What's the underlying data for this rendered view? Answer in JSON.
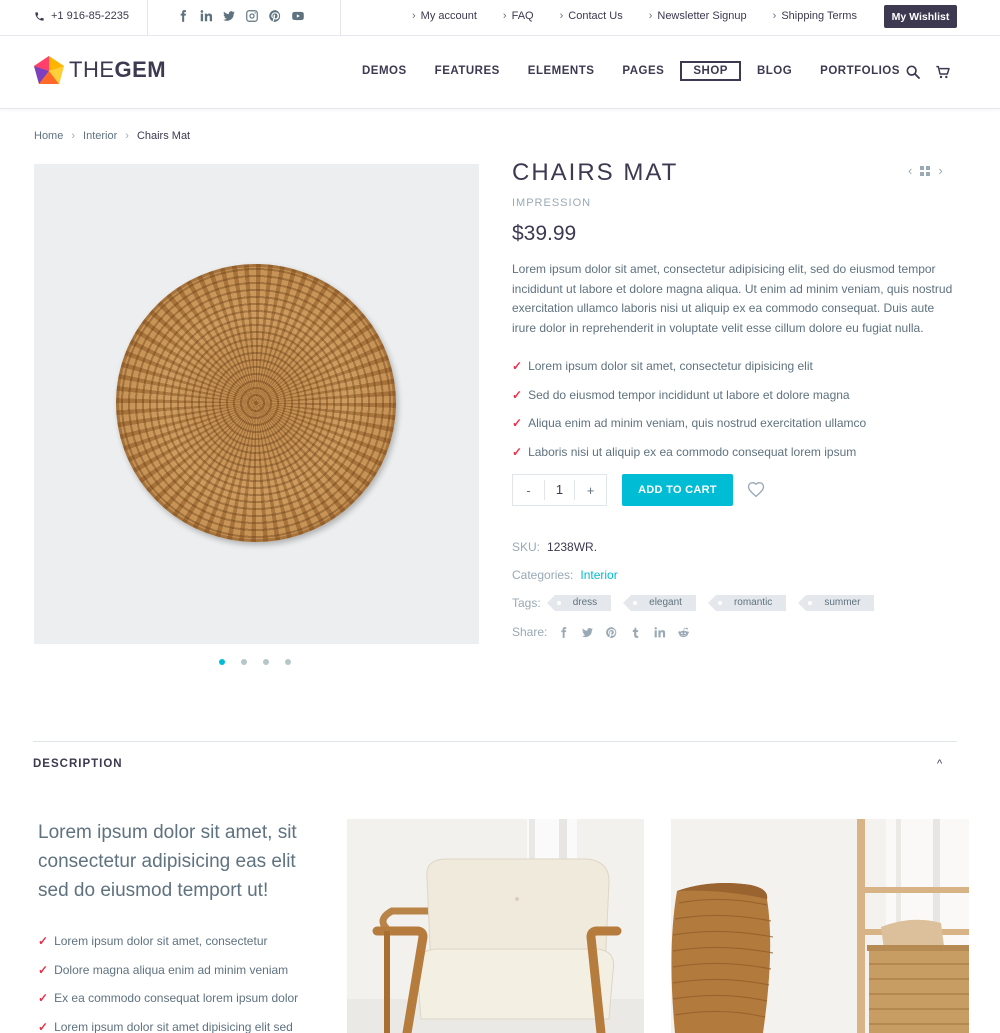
{
  "topbar": {
    "phone": "+1 916-85-2235",
    "social": [
      "facebook-icon",
      "linkedin-icon",
      "twitter-icon",
      "instagram-icon",
      "pinterest-icon",
      "youtube-icon"
    ],
    "links": [
      "My account",
      "FAQ",
      "Contact Us",
      "Newsletter Signup",
      "Shipping Terms"
    ],
    "wishlist_label": "My Wishlist"
  },
  "header": {
    "logo_thin": "THE",
    "logo_bold": "GEM",
    "nav": [
      "DEMOS",
      "FEATURES",
      "ELEMENTS",
      "PAGES",
      "SHOP",
      "BLOG",
      "PORTFOLIOS"
    ],
    "active_nav": "SHOP"
  },
  "breadcrumb": [
    "Home",
    "Interior",
    "Chairs Mat"
  ],
  "product": {
    "title": "CHAIRS MAT",
    "brand": "IMPRESSION",
    "price": "$39.99",
    "description": "Lorem ipsum dolor sit amet, consectetur adipisicing elit, sed do eiusmod tempor incididunt ut labore et dolore magna aliqua. Ut enim ad minim veniam, quis nostrud exercitation ullamco laboris nisi ut aliquip ex ea commodo consequat. Duis aute irure dolor in reprehenderit in voluptate velit esse cillum dolore eu fugiat nulla.",
    "features": [
      "Lorem ipsum dolor sit amet, consectetur dipisicing elit",
      "Sed do eiusmod tempor incididunt ut labore et dolore magna",
      "Aliqua enim ad minim veniam, quis nostrud exercitation ullamco",
      "Laboris nisi ut aliquip ex ea commodo consequat lorem ipsum"
    ],
    "qty_minus": "-",
    "qty_value": "1",
    "qty_plus": "+",
    "add_to_cart": "ADD TO CART",
    "sku_label": "SKU:",
    "sku": "1238WR.",
    "categories_label": "Categories:",
    "category": "Interior",
    "tags_label": "Tags:",
    "tags": [
      "dress",
      "elegant",
      "romantic",
      "summer"
    ],
    "share_label": "Share:",
    "share_icons": [
      "facebook-icon",
      "twitter-icon",
      "pinterest-icon",
      "tumblr-icon",
      "linkedin-icon",
      "reddit-icon"
    ],
    "gallery_slide_count": 4,
    "gallery_active_slide": 1
  },
  "description": {
    "heading": "DESCRIPTION",
    "toggle": "^",
    "lead": "Lorem ipsum dolor sit amet, sit consectetur adipisicing eas elit sed do eiusmod temport ut!",
    "items": [
      "Lorem ipsum dolor sit amet, consectetur",
      "Dolore magna aliqua enim ad minim veniam",
      "Ex ea commodo consequat lorem ipsum dolor",
      "Lorem ipsum dolor sit amet dipisicing elit sed"
    ]
  },
  "colors": {
    "accent": "#00bcd4",
    "dark": "#3c3950",
    "text": "#5f727f",
    "check": "#e8304a"
  }
}
